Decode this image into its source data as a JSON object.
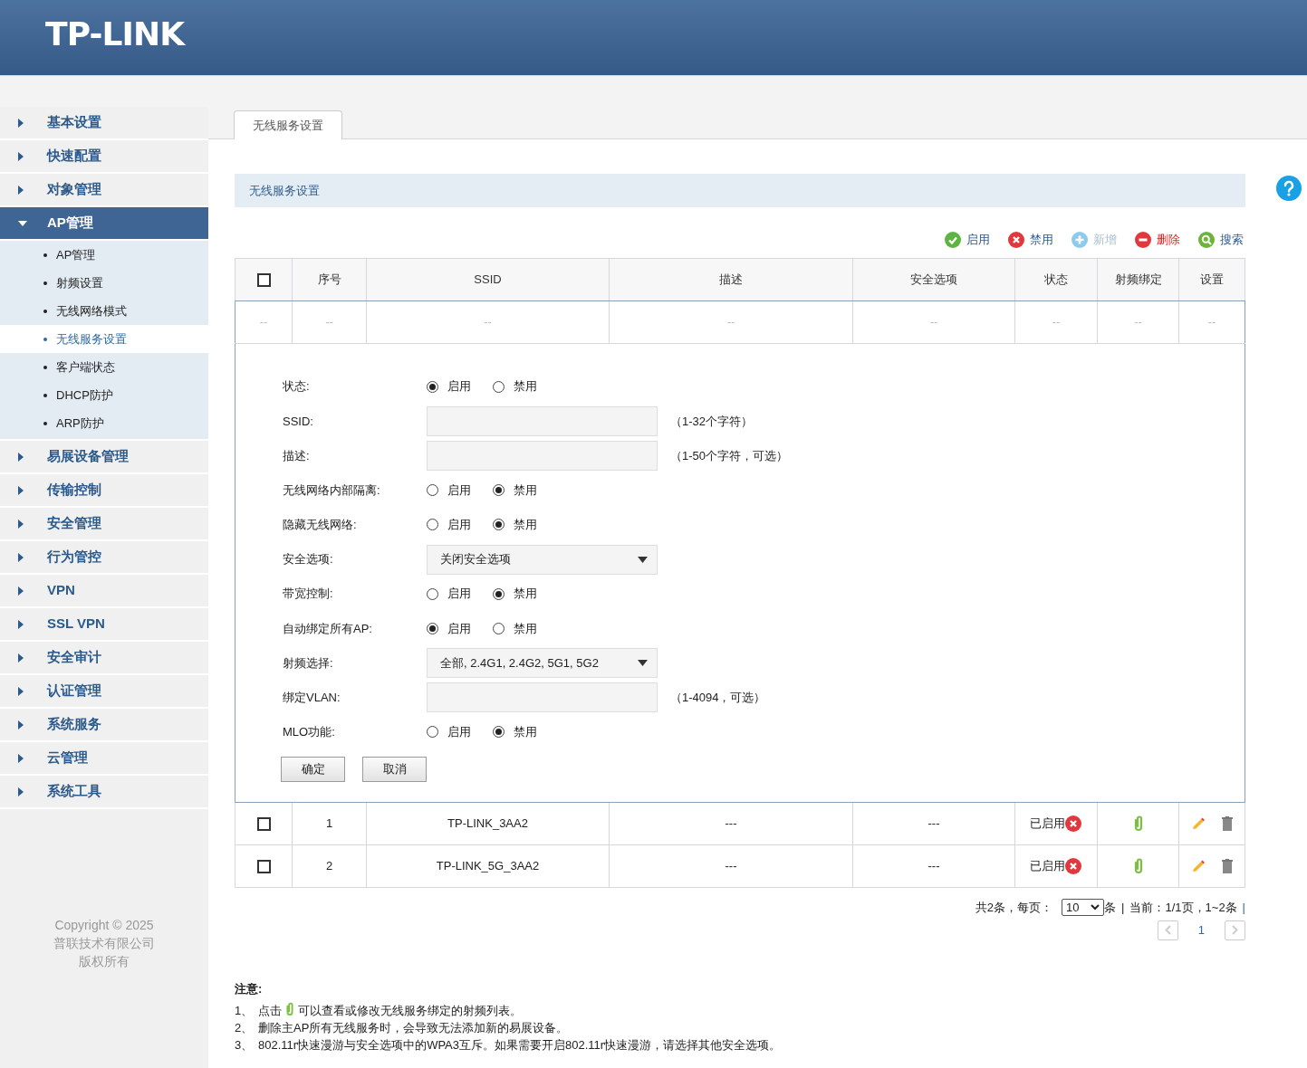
{
  "header": {
    "logo": "TP-LINK"
  },
  "sidebar": {
    "items": [
      {
        "label": "基本设置",
        "expanded": false
      },
      {
        "label": "快速配置",
        "expanded": false
      },
      {
        "label": "对象管理",
        "expanded": false
      },
      {
        "label": "AP管理",
        "expanded": true,
        "children": [
          {
            "label": "AP管理",
            "selected": false
          },
          {
            "label": "射频设置",
            "selected": false
          },
          {
            "label": "无线网络模式",
            "selected": false
          },
          {
            "label": "无线服务设置",
            "selected": true
          },
          {
            "label": "客户端状态",
            "selected": false
          },
          {
            "label": "DHCP防护",
            "selected": false
          },
          {
            "label": "ARP防护",
            "selected": false
          }
        ]
      },
      {
        "label": "易展设备管理",
        "expanded": false
      },
      {
        "label": "传输控制",
        "expanded": false
      },
      {
        "label": "安全管理",
        "expanded": false
      },
      {
        "label": "行为管控",
        "expanded": false
      },
      {
        "label": "VPN",
        "expanded": false
      },
      {
        "label": "SSL VPN",
        "expanded": false
      },
      {
        "label": "安全审计",
        "expanded": false
      },
      {
        "label": "认证管理",
        "expanded": false
      },
      {
        "label": "系统服务",
        "expanded": false
      },
      {
        "label": "云管理",
        "expanded": false
      },
      {
        "label": "系统工具",
        "expanded": false
      }
    ],
    "copyright": [
      "Copyright © 2025",
      "普联技术有限公司",
      "版权所有"
    ]
  },
  "tabs": [
    {
      "label": "无线服务设置",
      "selected": true
    }
  ],
  "panel": {
    "title": "无线服务设置"
  },
  "toolbar": [
    {
      "kind": "enable",
      "label": "启用",
      "disabled": false
    },
    {
      "kind": "disable",
      "label": "禁用",
      "disabled": false
    },
    {
      "kind": "add",
      "label": "新增",
      "disabled": true
    },
    {
      "kind": "delete",
      "label": "删除",
      "disabled": false
    },
    {
      "kind": "search",
      "label": "搜索",
      "disabled": false
    }
  ],
  "table": {
    "columns": [
      "序号",
      "SSID",
      "描述",
      "安全选项",
      "状态",
      "射频绑定",
      "设置"
    ],
    "header_checked": false,
    "placeholder_row": [
      "--",
      "--",
      "--",
      "--",
      "--",
      "--",
      "--",
      "--"
    ],
    "rows": [
      {
        "checked": false,
        "index": "1",
        "ssid": "TP-LINK_3AA2",
        "description": "---",
        "security": "---",
        "status": "已启用"
      },
      {
        "checked": false,
        "index": "2",
        "ssid": "TP-LINK_5G_3AA2",
        "description": "---",
        "security": "---",
        "status": "已启用"
      }
    ]
  },
  "form": {
    "fields": [
      {
        "kind": "radio",
        "label": "状态:",
        "options": [
          {
            "label": "启用",
            "selected": true
          },
          {
            "label": "禁用",
            "selected": false
          }
        ]
      },
      {
        "kind": "text",
        "label": "SSID:",
        "hint": "（1-32个字符）"
      },
      {
        "kind": "text",
        "label": "描述:",
        "hint": "（1-50个字符，可选）"
      },
      {
        "kind": "radio",
        "label": "无线网络内部隔离:",
        "options": [
          {
            "label": "启用",
            "selected": false
          },
          {
            "label": "禁用",
            "selected": true
          }
        ]
      },
      {
        "kind": "radio",
        "label": "隐藏无线网络:",
        "options": [
          {
            "label": "启用",
            "selected": false
          },
          {
            "label": "禁用",
            "selected": true
          }
        ]
      },
      {
        "kind": "select",
        "label": "安全选项:",
        "value": "关闭安全选项"
      },
      {
        "kind": "radio",
        "label": "带宽控制:",
        "options": [
          {
            "label": "启用",
            "selected": false
          },
          {
            "label": "禁用",
            "selected": true
          }
        ]
      },
      {
        "kind": "radio",
        "label": "自动绑定所有AP:",
        "options": [
          {
            "label": "启用",
            "selected": true
          },
          {
            "label": "禁用",
            "selected": false
          }
        ]
      },
      {
        "kind": "select",
        "label": "射频选择:",
        "value": "全部, 2.4G1, 2.4G2, 5G1, 5G2"
      },
      {
        "kind": "text",
        "label": "绑定VLAN:",
        "hint": "（1-4094，可选）"
      },
      {
        "kind": "radio",
        "label": "MLO功能:",
        "options": [
          {
            "label": "启用",
            "selected": false
          },
          {
            "label": "禁用",
            "selected": true
          }
        ]
      }
    ],
    "buttons": [
      "确定",
      "取消"
    ]
  },
  "pagination": {
    "total": "共2条，每页：",
    "per_page": "10",
    "unit": "条",
    "separator_1": "|",
    "current": "当前：1/1页，1~2条",
    "separator_2": "|",
    "page": "1"
  },
  "notes": {
    "title": "注意:",
    "items": [
      {
        "number": "1、",
        "text_before": "点击",
        "text_after": "可以查看或修改无线服务绑定的射频列表。"
      },
      {
        "number": "2、",
        "text": "删除主AP所有无线服务时，会导致无法添加新的易展设备。"
      },
      {
        "number": "3、",
        "text": "802.11r快速漫游与安全选项中的WPA3互斥。如果需要开启802.11r快速漫游，请选择其他安全选项。"
      }
    ]
  }
}
